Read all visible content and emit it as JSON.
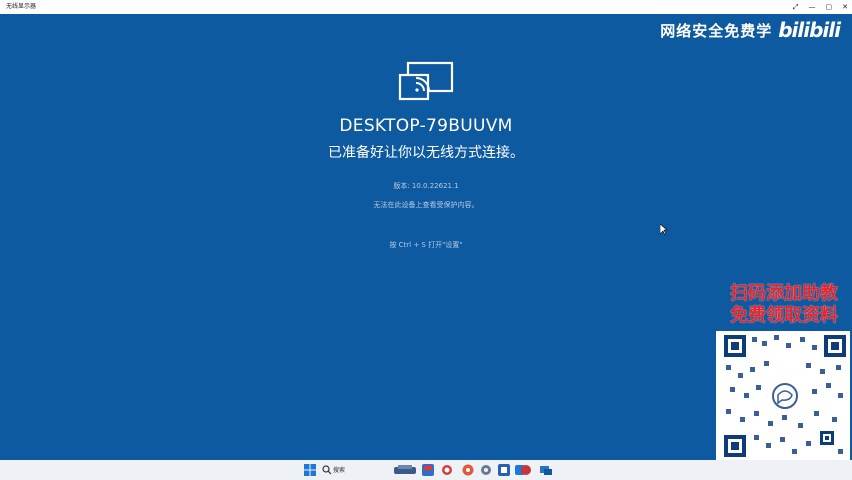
{
  "window": {
    "title": "无线显示器",
    "controls": [
      "⤢",
      "—",
      "▢",
      "✕"
    ]
  },
  "main": {
    "device_name": "DESKTOP-79BUUVM",
    "status_text": "已准备好让你以无线方式连接。",
    "version_text": "版本: 10.0.22621.1",
    "protect_text": "无法在此设备上查看受保护内容。",
    "hint_text": "按 Ctrl + S 打开\"设置\""
  },
  "watermark": {
    "text": "网络安全免费学",
    "logo_text": "bilibili"
  },
  "promo": {
    "line1": "扫码添加助教",
    "line2": "免费领取资料"
  },
  "taskbar": {
    "search_label": "搜索"
  },
  "colors": {
    "background": "#0e5aa0",
    "promo_red": "#e8232a"
  }
}
